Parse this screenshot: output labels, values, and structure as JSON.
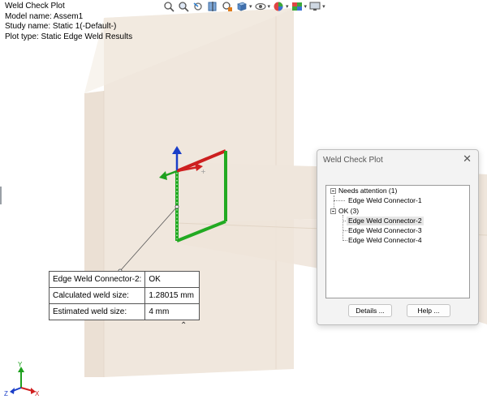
{
  "info": {
    "title": "Weld Check Plot",
    "model": "Model name: Assem1",
    "study": "Study name: Static 1(-Default-)",
    "plot_type": "Plot type: Static Edge Weld Results"
  },
  "toolbar": {
    "items": [
      {
        "icon": "zoom-fit-icon"
      },
      {
        "icon": "zoom-area-icon"
      },
      {
        "icon": "previous-view-icon"
      },
      {
        "icon": "section-view-icon"
      },
      {
        "icon": "dynamic-annotation-icon"
      },
      {
        "icon": "view-orientation-icon"
      },
      {
        "icon": "display-style-icon"
      },
      {
        "icon": "hide-show-items-icon"
      },
      {
        "icon": "edit-appearance-icon"
      },
      {
        "icon": "apply-scene-icon"
      },
      {
        "icon": "view-settings-icon"
      }
    ]
  },
  "callout": {
    "rows": [
      {
        "label": "Edge Weld Connector-2:",
        "value": "OK"
      },
      {
        "label": "Calculated weld size:",
        "value": "1.28015 mm"
      },
      {
        "label": "Estimated weld size:",
        "value": "4 mm"
      }
    ]
  },
  "dialog": {
    "title": "Weld Check Plot",
    "close": "✕",
    "tree": {
      "groups": [
        {
          "label": "Needs attention (1)",
          "children": [
            "Edge Weld Connector-1"
          ]
        },
        {
          "label": "OK (3)",
          "children": [
            "Edge Weld Connector-2",
            "Edge Weld Connector-3",
            "Edge Weld Connector-4"
          ]
        }
      ],
      "selected": "Edge Weld Connector-2"
    },
    "buttons": {
      "details": "Details ...",
      "help": "Help ..."
    }
  },
  "triad": {
    "x_label": "X",
    "y_label": "Y",
    "z_label": "Z"
  },
  "colors": {
    "plate": "#efe6dc",
    "plate_edge": "#e2d6c8",
    "weld_ok": "#22aa22",
    "weld_red": "#cc1f1f",
    "axis_blue": "#1a3ec8",
    "axis_red": "#d02020",
    "axis_green": "#1ea01e"
  }
}
